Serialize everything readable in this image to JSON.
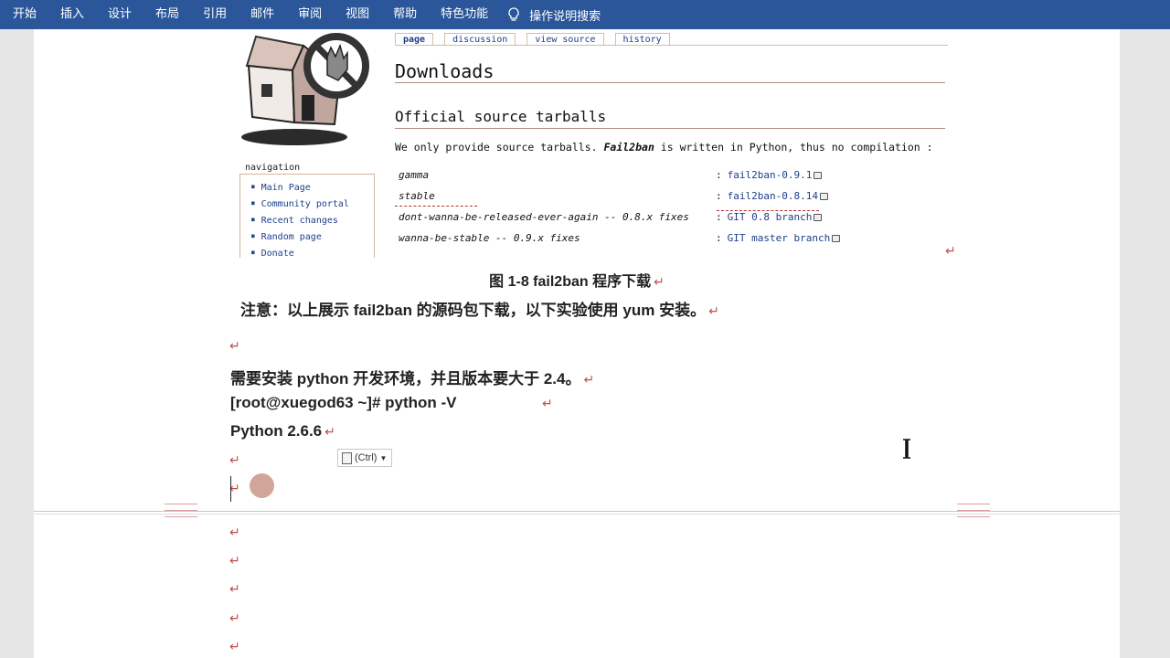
{
  "ribbon": {
    "tabs": [
      "开始",
      "插入",
      "设计",
      "布局",
      "引用",
      "邮件",
      "审阅",
      "视图",
      "帮助",
      "特色功能"
    ],
    "tell_me": "操作说明搜索"
  },
  "screenshot": {
    "wiki_tabs": [
      "page",
      "discussion",
      "view source",
      "history"
    ],
    "navigation_title": "navigation",
    "navigation_items": [
      "Main Page",
      "Community portal",
      "Recent changes",
      "Random page",
      "Donate"
    ],
    "heading": "Downloads",
    "subheading": "Official source tarballs",
    "intro_pre": "We only provide source tarballs. ",
    "intro_bold": "Fail2ban",
    "intro_post": " is written in Python, thus no compilation :",
    "downloads": [
      {
        "name": "gamma",
        "link": "fail2ban-0.9.1"
      },
      {
        "name": "stable",
        "link": "fail2ban-0.8.14"
      },
      {
        "name": "dont-wanna-be-released-ever-again -- 0.8.x fixes",
        "link": "GIT 0.8 branch"
      },
      {
        "name": "wanna-be-stable -- 0.9.x fixes",
        "link": "GIT master branch"
      }
    ]
  },
  "document": {
    "caption": "图  1-8 fail2ban 程序下载",
    "note": "注意：以上展示 fail2ban 的源码包下载，以下实验使用 yum 安装。",
    "line1": "需要安装 python 开发环境，并且版本要大于 2.4。",
    "line2": "[root@xuegod63 ~]# python -V",
    "line3": "Python 2.6.6",
    "paragraph_mark": "↵",
    "paste_label": "(Ctrl)"
  },
  "colors": {
    "ribbon_bg": "#2b579a",
    "link": "#1d3f8a",
    "paragraph_mark": "#c0504d"
  }
}
